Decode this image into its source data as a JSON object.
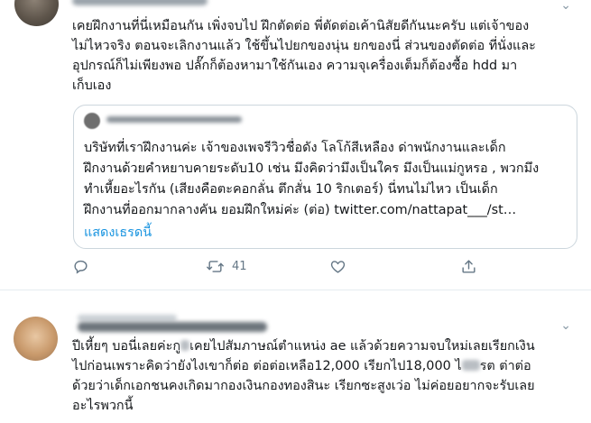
{
  "tweets": [
    {
      "text": "เคยฝึกงานที่นี่เหมือนกัน เพิ่งจบไป ฝึกตัดต่อ พี่ตัดต่อเค้านิสัยดีกันนะครับ แต่เจ้าของ\nไม่ไหวจริง ตอนจะเลิกงานแล้ว ใช้ขึ้นไปยกของนุ่น ยกของนี่ ส่วนของตัดต่อ ที่นั่งและ\nอุปกรณ์ก็ไม่เพียงพอ ปลั๊กก็ต้องหามาใช้กันเอง ความจุเครื่องเต็มก็ต้องซื้อ hdd มา\nเก็บเอง",
      "quote": {
        "text": "บริษัทที่เราฝึกงานค่ะ เจ้าของเพจรีวิวชื่อดัง โลโก้สีเหลือง ด่าพนักงานและเด็ก\nฝึกงานด้วยคำหยาบคายระดับ10 เช่น มึงคิดว่ามึงเป็นใคร มึงเป็นแม่กูหรอ , พวกมึง\nทำเหี้ยอะไรกัน (เสียงคือตะคอกลั่น ตึกสั่น 10 ริกเตอร์) นี่ทนไม่ไหว เป็นเด็ก\nฝึกงานที่ออกมากลางคัน ยอมฝึกใหม่ค่ะ (ต่อ) twitter.com/nattapat___/st…",
        "show_thread": "แสดงเธรดนี้"
      },
      "retweet_count": "41"
    },
    {
      "text_parts": {
        "line1_a": "ปีเหี้ยๆ บอนี่เลยค่ะกู",
        "line1_b": "เคยไปสัมภาษณ์ตำแหน่ง ae แล้วด้วยความจบใหม่เลยเรียกเงิน",
        "line2_a": "ไปก่อนเพราะคิดว่ายังไงเขาก็ต่อ ต่อต่อเหลือ12,000 เรียกไป18,000 ไ",
        "line2_b": "รต ต่าต่อ",
        "line3": "ด้วยว่าเด็กเอกชนคงเกิดมากองเงินกองทองสินะ เรียกซะสูงเว่อ ไม่ค่อยอยากจะรับเลย",
        "line4": "อะไรพวกนี้"
      }
    }
  ],
  "colors": {
    "link": "#1b95e0",
    "muted": "#657786",
    "border": "#ccd6dd"
  },
  "icons": [
    "chevron-down-icon",
    "reply-icon",
    "retweet-icon",
    "like-icon",
    "share-icon"
  ]
}
